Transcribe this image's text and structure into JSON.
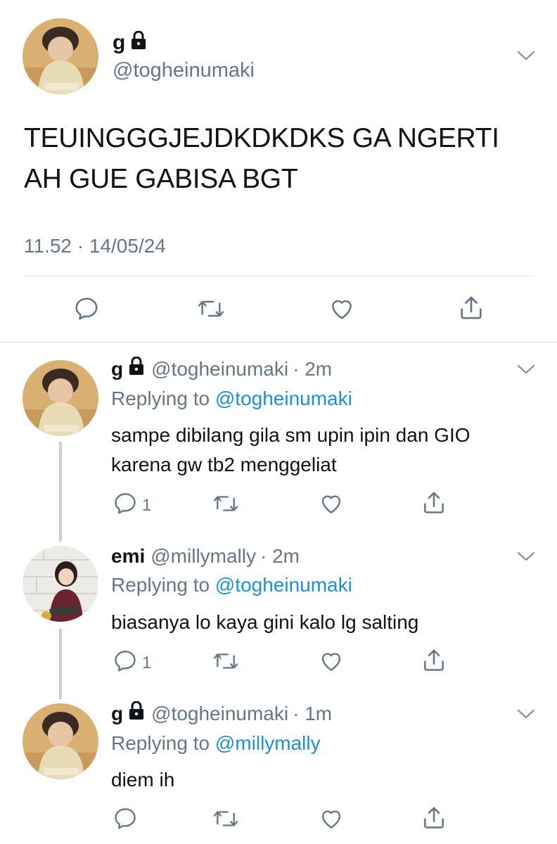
{
  "main_tweet": {
    "name": "g",
    "handle": "@togheinumaki",
    "text": "TEUINGGGJEJDKDKDKS GA NGERTI AH GUE GABISA BGT",
    "meta": "11.52 · 14/05/24"
  },
  "replies": [
    {
      "name": "g",
      "handle": "@togheinumaki",
      "time": "· 2m",
      "replying_prefix": "Replying to",
      "replying_to": "@togheinumaki",
      "text": "sampe dibilang gila sm upin ipin dan GIO karena gw tb2 menggeliat",
      "reply_count": "1",
      "locked": true
    },
    {
      "name": "emi",
      "handle": "@millymally",
      "time": "· 2m",
      "replying_prefix": "Replying to",
      "replying_to": "@togheinumaki",
      "text": "biasanya lo kaya gini kalo lg salting",
      "reply_count": "1",
      "locked": false
    },
    {
      "name": "g",
      "handle": "@togheinumaki",
      "time": "· 1m",
      "replying_prefix": "Replying to",
      "replying_to": "@millymally",
      "text": "diem ih",
      "reply_count": "",
      "locked": true
    }
  ],
  "icons": {
    "reply": "reply-icon",
    "retweet": "retweet-icon",
    "like": "heart-icon",
    "share": "share-icon",
    "lock": "lock-icon",
    "more": "chevron-down-icon"
  },
  "colors": {
    "text": "#0f1419",
    "secondary": "#657786",
    "mention": "#1a91da",
    "divider": "#d9dee2",
    "thread_line": "#c4cfd6"
  }
}
